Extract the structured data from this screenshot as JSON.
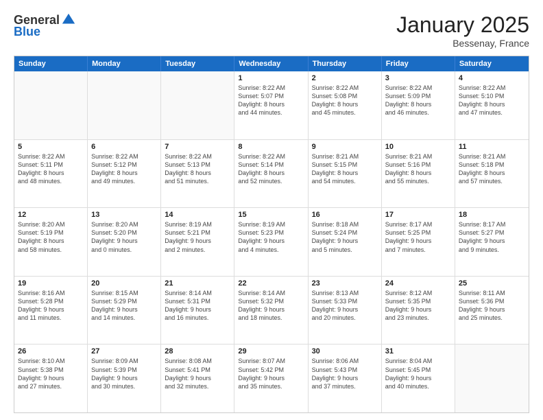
{
  "logo": {
    "general": "General",
    "blue": "Blue"
  },
  "title": "January 2025",
  "location": "Bessenay, France",
  "weekdays": [
    "Sunday",
    "Monday",
    "Tuesday",
    "Wednesday",
    "Thursday",
    "Friday",
    "Saturday"
  ],
  "rows": [
    [
      {
        "day": "",
        "lines": []
      },
      {
        "day": "",
        "lines": []
      },
      {
        "day": "",
        "lines": []
      },
      {
        "day": "1",
        "lines": [
          "Sunrise: 8:22 AM",
          "Sunset: 5:07 PM",
          "Daylight: 8 hours",
          "and 44 minutes."
        ]
      },
      {
        "day": "2",
        "lines": [
          "Sunrise: 8:22 AM",
          "Sunset: 5:08 PM",
          "Daylight: 8 hours",
          "and 45 minutes."
        ]
      },
      {
        "day": "3",
        "lines": [
          "Sunrise: 8:22 AM",
          "Sunset: 5:09 PM",
          "Daylight: 8 hours",
          "and 46 minutes."
        ]
      },
      {
        "day": "4",
        "lines": [
          "Sunrise: 8:22 AM",
          "Sunset: 5:10 PM",
          "Daylight: 8 hours",
          "and 47 minutes."
        ]
      }
    ],
    [
      {
        "day": "5",
        "lines": [
          "Sunrise: 8:22 AM",
          "Sunset: 5:11 PM",
          "Daylight: 8 hours",
          "and 48 minutes."
        ]
      },
      {
        "day": "6",
        "lines": [
          "Sunrise: 8:22 AM",
          "Sunset: 5:12 PM",
          "Daylight: 8 hours",
          "and 49 minutes."
        ]
      },
      {
        "day": "7",
        "lines": [
          "Sunrise: 8:22 AM",
          "Sunset: 5:13 PM",
          "Daylight: 8 hours",
          "and 51 minutes."
        ]
      },
      {
        "day": "8",
        "lines": [
          "Sunrise: 8:22 AM",
          "Sunset: 5:14 PM",
          "Daylight: 8 hours",
          "and 52 minutes."
        ]
      },
      {
        "day": "9",
        "lines": [
          "Sunrise: 8:21 AM",
          "Sunset: 5:15 PM",
          "Daylight: 8 hours",
          "and 54 minutes."
        ]
      },
      {
        "day": "10",
        "lines": [
          "Sunrise: 8:21 AM",
          "Sunset: 5:16 PM",
          "Daylight: 8 hours",
          "and 55 minutes."
        ]
      },
      {
        "day": "11",
        "lines": [
          "Sunrise: 8:21 AM",
          "Sunset: 5:18 PM",
          "Daylight: 8 hours",
          "and 57 minutes."
        ]
      }
    ],
    [
      {
        "day": "12",
        "lines": [
          "Sunrise: 8:20 AM",
          "Sunset: 5:19 PM",
          "Daylight: 8 hours",
          "and 58 minutes."
        ]
      },
      {
        "day": "13",
        "lines": [
          "Sunrise: 8:20 AM",
          "Sunset: 5:20 PM",
          "Daylight: 9 hours",
          "and 0 minutes."
        ]
      },
      {
        "day": "14",
        "lines": [
          "Sunrise: 8:19 AM",
          "Sunset: 5:21 PM",
          "Daylight: 9 hours",
          "and 2 minutes."
        ]
      },
      {
        "day": "15",
        "lines": [
          "Sunrise: 8:19 AM",
          "Sunset: 5:23 PM",
          "Daylight: 9 hours",
          "and 4 minutes."
        ]
      },
      {
        "day": "16",
        "lines": [
          "Sunrise: 8:18 AM",
          "Sunset: 5:24 PM",
          "Daylight: 9 hours",
          "and 5 minutes."
        ]
      },
      {
        "day": "17",
        "lines": [
          "Sunrise: 8:17 AM",
          "Sunset: 5:25 PM",
          "Daylight: 9 hours",
          "and 7 minutes."
        ]
      },
      {
        "day": "18",
        "lines": [
          "Sunrise: 8:17 AM",
          "Sunset: 5:27 PM",
          "Daylight: 9 hours",
          "and 9 minutes."
        ]
      }
    ],
    [
      {
        "day": "19",
        "lines": [
          "Sunrise: 8:16 AM",
          "Sunset: 5:28 PM",
          "Daylight: 9 hours",
          "and 11 minutes."
        ]
      },
      {
        "day": "20",
        "lines": [
          "Sunrise: 8:15 AM",
          "Sunset: 5:29 PM",
          "Daylight: 9 hours",
          "and 14 minutes."
        ]
      },
      {
        "day": "21",
        "lines": [
          "Sunrise: 8:14 AM",
          "Sunset: 5:31 PM",
          "Daylight: 9 hours",
          "and 16 minutes."
        ]
      },
      {
        "day": "22",
        "lines": [
          "Sunrise: 8:14 AM",
          "Sunset: 5:32 PM",
          "Daylight: 9 hours",
          "and 18 minutes."
        ]
      },
      {
        "day": "23",
        "lines": [
          "Sunrise: 8:13 AM",
          "Sunset: 5:33 PM",
          "Daylight: 9 hours",
          "and 20 minutes."
        ]
      },
      {
        "day": "24",
        "lines": [
          "Sunrise: 8:12 AM",
          "Sunset: 5:35 PM",
          "Daylight: 9 hours",
          "and 23 minutes."
        ]
      },
      {
        "day": "25",
        "lines": [
          "Sunrise: 8:11 AM",
          "Sunset: 5:36 PM",
          "Daylight: 9 hours",
          "and 25 minutes."
        ]
      }
    ],
    [
      {
        "day": "26",
        "lines": [
          "Sunrise: 8:10 AM",
          "Sunset: 5:38 PM",
          "Daylight: 9 hours",
          "and 27 minutes."
        ]
      },
      {
        "day": "27",
        "lines": [
          "Sunrise: 8:09 AM",
          "Sunset: 5:39 PM",
          "Daylight: 9 hours",
          "and 30 minutes."
        ]
      },
      {
        "day": "28",
        "lines": [
          "Sunrise: 8:08 AM",
          "Sunset: 5:41 PM",
          "Daylight: 9 hours",
          "and 32 minutes."
        ]
      },
      {
        "day": "29",
        "lines": [
          "Sunrise: 8:07 AM",
          "Sunset: 5:42 PM",
          "Daylight: 9 hours",
          "and 35 minutes."
        ]
      },
      {
        "day": "30",
        "lines": [
          "Sunrise: 8:06 AM",
          "Sunset: 5:43 PM",
          "Daylight: 9 hours",
          "and 37 minutes."
        ]
      },
      {
        "day": "31",
        "lines": [
          "Sunrise: 8:04 AM",
          "Sunset: 5:45 PM",
          "Daylight: 9 hours",
          "and 40 minutes."
        ]
      },
      {
        "day": "",
        "lines": []
      }
    ]
  ]
}
